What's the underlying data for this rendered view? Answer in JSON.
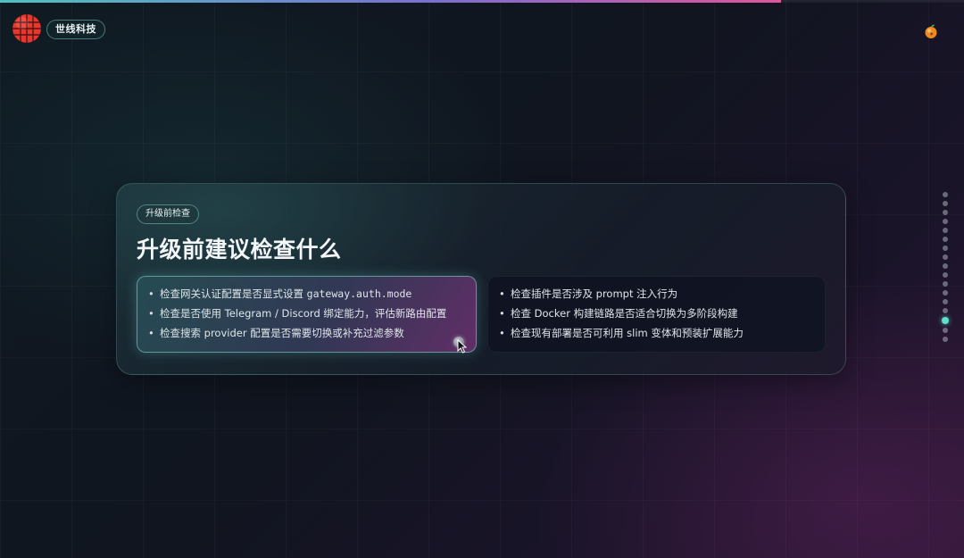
{
  "header": {
    "brand": "世线科技",
    "progress_fraction": 0.81
  },
  "slide": {
    "tag": "升级前检查",
    "title": "升级前建议检查什么",
    "left_items": [
      {
        "text": "检查网关认证配置是否显式设置 ",
        "code": "gateway.auth.mode"
      },
      {
        "text": "检查是否使用 Telegram / Discord 绑定能力，评估新路由配置"
      },
      {
        "text": "检查搜索 provider 配置是否需要切换或补充过滤参数"
      }
    ],
    "right_items": [
      {
        "text": "检查插件是否涉及 prompt 注入行为"
      },
      {
        "text": "检查 Docker 构建链路是否适合切换为多阶段构建"
      },
      {
        "text": "检查现有部署是否可利用 slim 变体和预装扩展能力"
      }
    ]
  },
  "navigation": {
    "total_slides": 17,
    "active_index": 14
  },
  "colors": {
    "accent": "#5fe0cf",
    "accent_pink": "#e0559a",
    "logo_red": "#e8372f"
  },
  "icons": {
    "logo": "red-globe-logo",
    "fruit": "orange-fruit-icon",
    "cursor": "mouse-pointer-icon"
  }
}
